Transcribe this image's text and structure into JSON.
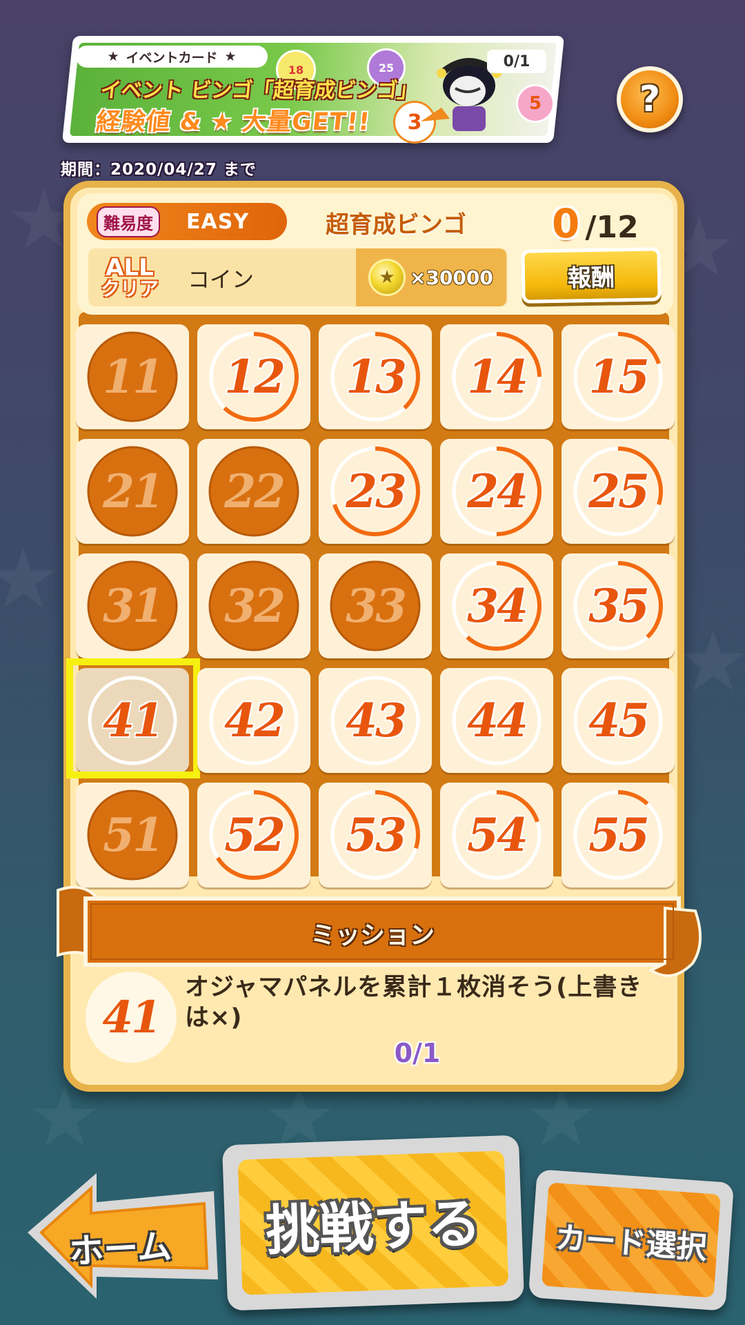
{
  "banner": {
    "tag_label": "イベントカード",
    "title_line1": "イベント ビンゴ「超育成ビンゴ」",
    "title_line2": "経験値 & ★ 大量GET!!",
    "count": "0/1",
    "balls": [
      "18",
      "25",
      "3",
      "5"
    ]
  },
  "period": "期間：2020/04/27 まで",
  "header": {
    "difficulty_label": "難易度",
    "difficulty_value": "EASY",
    "bingo_name": "超育成ビンゴ",
    "progress_current": "0",
    "progress_total": "/12",
    "allclear_line1": "ALL",
    "allclear_line2": "クリア",
    "reward_name": "コイン",
    "reward_amount": "×30000",
    "reward_button": "報酬"
  },
  "grid": {
    "cells": [
      {
        "label": "11",
        "done": true,
        "progress": 0
      },
      {
        "label": "12",
        "done": false,
        "progress": 0.62
      },
      {
        "label": "13",
        "done": false,
        "progress": 0.38
      },
      {
        "label": "14",
        "done": false,
        "progress": 0.25
      },
      {
        "label": "15",
        "done": false,
        "progress": 0.2
      },
      {
        "label": "21",
        "done": true,
        "progress": 0
      },
      {
        "label": "22",
        "done": true,
        "progress": 0
      },
      {
        "label": "23",
        "done": false,
        "progress": 0.7
      },
      {
        "label": "24",
        "done": false,
        "progress": 0.5
      },
      {
        "label": "25",
        "done": false,
        "progress": 0.3
      },
      {
        "label": "31",
        "done": true,
        "progress": 0
      },
      {
        "label": "32",
        "done": true,
        "progress": 0
      },
      {
        "label": "33",
        "done": true,
        "progress": 0
      },
      {
        "label": "34",
        "done": false,
        "progress": 0.62
      },
      {
        "label": "35",
        "done": false,
        "progress": 0.38
      },
      {
        "label": "41",
        "done": false,
        "progress": 0,
        "selected": true
      },
      {
        "label": "42",
        "done": false,
        "progress": 0
      },
      {
        "label": "43",
        "done": false,
        "progress": 0
      },
      {
        "label": "44",
        "done": false,
        "progress": 0
      },
      {
        "label": "45",
        "done": false,
        "progress": 0
      },
      {
        "label": "51",
        "done": true,
        "progress": 0
      },
      {
        "label": "52",
        "done": false,
        "progress": 0.66
      },
      {
        "label": "53",
        "done": false,
        "progress": 0.3
      },
      {
        "label": "54",
        "done": false,
        "progress": 0.2
      },
      {
        "label": "55",
        "done": false,
        "progress": 0.12
      }
    ]
  },
  "mission": {
    "title": "ミッション",
    "number": "41",
    "text": "オジャマパネルを累計１枚消そう(上書きは×)",
    "progress": "0/1"
  },
  "buttons": {
    "help": "?",
    "home": "ホーム",
    "challenge": "挑戦する",
    "card_select": "カード選択"
  },
  "colors": {
    "accent": "#e8560e",
    "done_circle": "#d97010",
    "board": "#d27a14",
    "mission_progress": "#8a5ac8",
    "highlight": "#f6f010"
  }
}
